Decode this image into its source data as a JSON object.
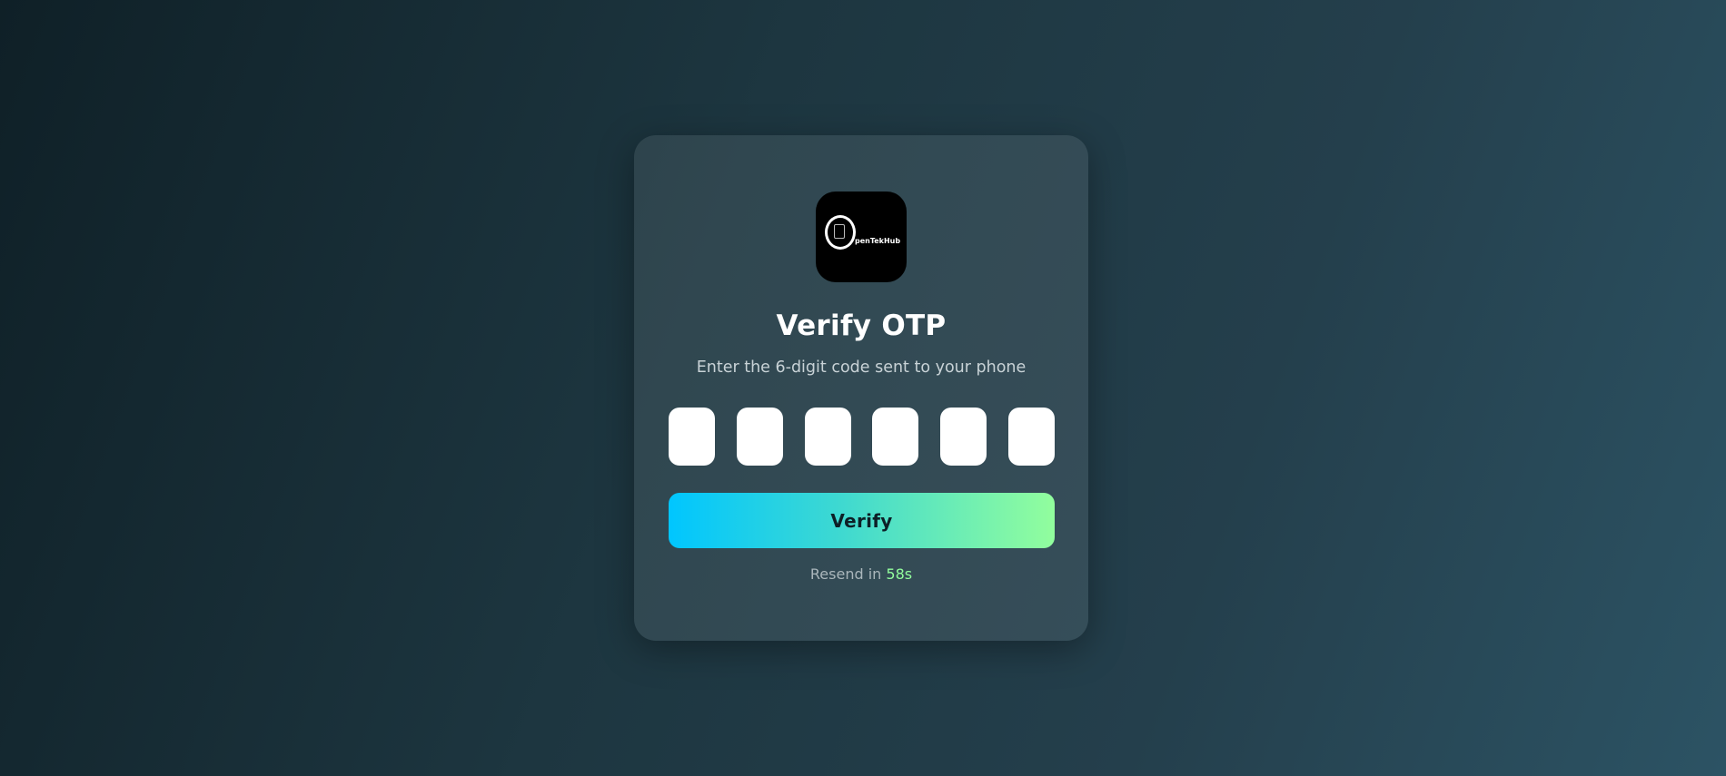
{
  "logo": {
    "text": "penTekHub",
    "icon": "opentekhub-logo-icon"
  },
  "title": "Verify OTP",
  "subtitle": "Enter the 6-digit code sent to your phone",
  "otp": {
    "digits": [
      "",
      "",
      "",
      "",
      "",
      ""
    ]
  },
  "verify_button": {
    "label": "Verify"
  },
  "resend": {
    "label": "Resend in",
    "countdown": "58s"
  },
  "colors": {
    "accent_start": "#00c6ff",
    "accent_end": "#92fe9d",
    "timer": "#92fe9d"
  }
}
